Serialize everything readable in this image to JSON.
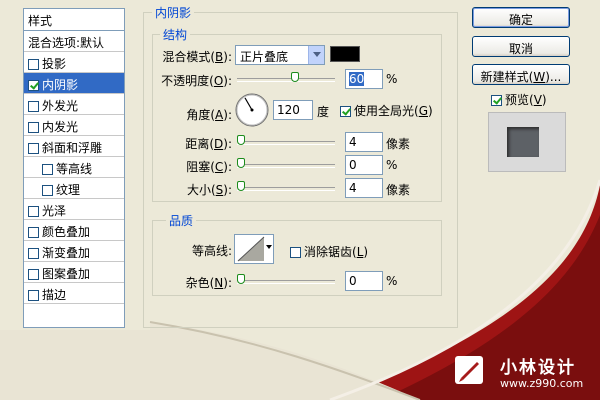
{
  "style_panel": {
    "header": "样式",
    "items": [
      {
        "label": "混合选项:默认",
        "checkbox": false,
        "checked": false,
        "selected": false,
        "indent": 0
      },
      {
        "label": "投影",
        "checkbox": true,
        "checked": false,
        "selected": false,
        "indent": 0
      },
      {
        "label": "内阴影",
        "checkbox": true,
        "checked": true,
        "selected": true,
        "indent": 0
      },
      {
        "label": "外发光",
        "checkbox": true,
        "checked": false,
        "selected": false,
        "indent": 0
      },
      {
        "label": "内发光",
        "checkbox": true,
        "checked": false,
        "selected": false,
        "indent": 0
      },
      {
        "label": "斜面和浮雕",
        "checkbox": true,
        "checked": false,
        "selected": false,
        "indent": 0
      },
      {
        "label": "等高线",
        "checkbox": true,
        "checked": false,
        "selected": false,
        "indent": 1
      },
      {
        "label": "纹理",
        "checkbox": true,
        "checked": false,
        "selected": false,
        "indent": 1
      },
      {
        "label": "光泽",
        "checkbox": true,
        "checked": false,
        "selected": false,
        "indent": 0
      },
      {
        "label": "颜色叠加",
        "checkbox": true,
        "checked": false,
        "selected": false,
        "indent": 0
      },
      {
        "label": "渐变叠加",
        "checkbox": true,
        "checked": false,
        "selected": false,
        "indent": 0
      },
      {
        "label": "图案叠加",
        "checkbox": true,
        "checked": false,
        "selected": false,
        "indent": 0
      },
      {
        "label": "描边",
        "checkbox": true,
        "checked": false,
        "selected": false,
        "indent": 0
      }
    ]
  },
  "inner_shadow": {
    "title": "内阴影",
    "structure": {
      "title": "结构",
      "blend_mode": {
        "label_pre": "混合模式(",
        "key": "B",
        "label_post": "):",
        "value": "正片叠底",
        "color": "#000000"
      },
      "opacity": {
        "label_pre": "不透明度(",
        "key": "O",
        "label_post": "):",
        "value": "60",
        "unit": "%",
        "fraction": 0.6
      },
      "angle": {
        "label_pre": "角度(",
        "key": "A",
        "label_post": "):",
        "value": "120",
        "unit": "度",
        "degrees": 120,
        "global_light": {
          "label_pre": "使用全局光(",
          "key": "G",
          "label_post": ")",
          "checked": true
        }
      },
      "distance": {
        "label_pre": "距离(",
        "key": "D",
        "label_post": "):",
        "value": "4",
        "unit": "像素",
        "fraction": 0.0
      },
      "choke": {
        "label_pre": "阻塞(",
        "key": "C",
        "label_post": "):",
        "value": "0",
        "unit": "%",
        "fraction": 0.0
      },
      "size": {
        "label_pre": "大小(",
        "key": "S",
        "label_post": "):",
        "value": "4",
        "unit": "像素",
        "fraction": 0.0
      }
    },
    "quality": {
      "title": "品质",
      "contour": {
        "label": "等高线:"
      },
      "anti_alias": {
        "label_pre": "消除锯齿(",
        "key": "L",
        "label_post": ")",
        "checked": false
      },
      "noise": {
        "label_pre": "杂色(",
        "key": "N",
        "label_post": "):",
        "value": "0",
        "unit": "%",
        "fraction": 0.0
      }
    }
  },
  "buttons": {
    "ok": "确定",
    "cancel": "取消",
    "new_style": {
      "label_pre": "新建样式(",
      "key": "W",
      "label_post": ")..."
    }
  },
  "preview": {
    "label_pre": "预览(",
    "key": "V",
    "label_post": ")",
    "checked": true
  },
  "watermark": {
    "name": "小林设计",
    "url": "www.z990.com"
  },
  "colors": {
    "accent": "#316AC5",
    "legend": "#0046D5",
    "curl_red": "#A61B1B"
  }
}
